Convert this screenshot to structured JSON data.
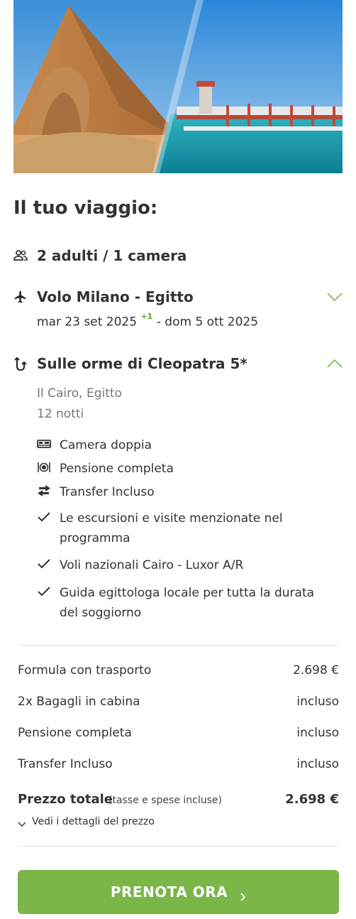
{
  "trip_title": "Il tuo viaggio:",
  "travellers": "2 adulti / 1 camera",
  "flight": {
    "title": "Volo Milano - Egitto",
    "date_from": "mar 23 set 2025",
    "day_offset": "+1",
    "date_to": "- dom 5 ott 2025"
  },
  "hotel": {
    "title": "Sulle orme di Cleopatra 5*",
    "location": "Il Cairo, Egitto",
    "nights": "12 notti",
    "features": [
      {
        "icon": "bed-icon",
        "label": "Camera doppia"
      },
      {
        "icon": "meal-icon",
        "label": "Pensione completa"
      },
      {
        "icon": "transfer-icon",
        "label": "Transfer Incluso"
      },
      {
        "icon": "check-icon",
        "label": "Le escursioni e visite menzionate nel programma"
      },
      {
        "icon": "check-icon",
        "label": "Voli nazionali Cairo - Luxor A/R"
      },
      {
        "icon": "check-icon",
        "label": "Guida egittologa locale per tutta la durata del soggiorno"
      }
    ]
  },
  "price": {
    "rows": [
      {
        "label": "Formula con trasporto",
        "value": "2.698 €"
      },
      {
        "label": "2x Bagagli in cabina",
        "value": "incluso"
      },
      {
        "label": "Pensione completa",
        "value": "incluso"
      },
      {
        "label": "Transfer Incluso",
        "value": "incluso"
      }
    ],
    "total_label": "Prezzo totale",
    "total_note": "(tasse e spese incluse)",
    "total_value": "2.698 €",
    "details_link": "Vedi i dettagli del prezzo"
  },
  "cta": "PRENOTA ORA",
  "colors": {
    "accent": "#7ab648",
    "offset": "#5aa32b"
  }
}
